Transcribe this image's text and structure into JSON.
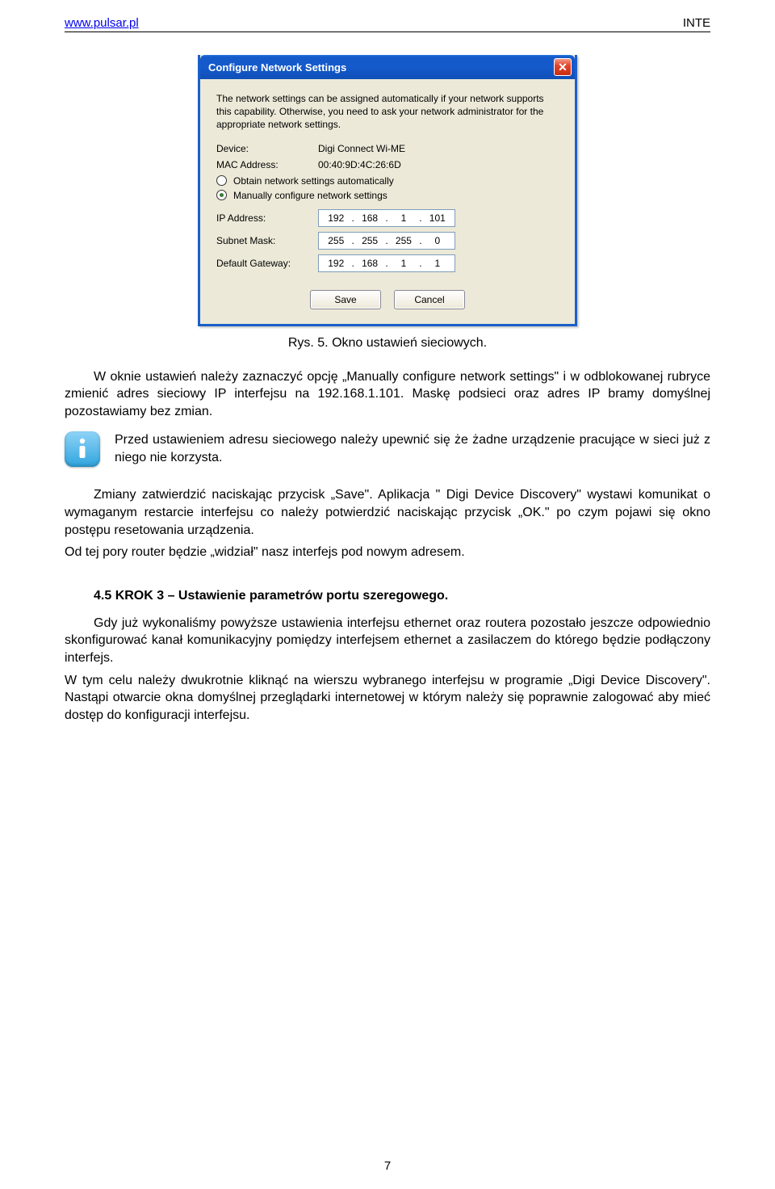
{
  "header": {
    "left_url": "www.pulsar.pl",
    "right": "INTE"
  },
  "dialog": {
    "title": "Configure Network Settings",
    "description": "The network settings can be assigned automatically if your network supports this capability. Otherwise, you need to ask your network administrator for the appropriate network settings.",
    "device_label": "Device:",
    "device_value": "Digi Connect Wi-ME",
    "mac_label": "MAC Address:",
    "mac_value": "00:40:9D:4C:26:6D",
    "radio_auto": "Obtain network settings automatically",
    "radio_manual": "Manually configure network settings",
    "ip_label": "IP Address:",
    "ip_value": [
      "192",
      "168",
      "1",
      "101"
    ],
    "mask_label": "Subnet Mask:",
    "mask_value": [
      "255",
      "255",
      "255",
      "0"
    ],
    "gw_label": "Default Gateway:",
    "gw_value": [
      "192",
      "168",
      "1",
      "1"
    ],
    "save": "Save",
    "cancel": "Cancel"
  },
  "caption": "Rys. 5. Okno ustawień sieciowych.",
  "body": {
    "p1": "W oknie ustawień należy zaznaczyć opcję „Manually configure network settings\" i w odblokowanej rubryce zmienić adres sieciowy IP interfejsu na 192.168.1.101. Maskę podsieci oraz adres IP bramy domyślnej pozostawiamy bez zmian.",
    "info": "Przed ustawieniem adresu sieciowego należy upewnić się że żadne urządzenie pracujące w sieci już z niego nie korzysta.",
    "p2": "Zmiany zatwierdzić naciskając przycisk „Save\". Aplikacja \" Digi Device Discovery\" wystawi komunikat o wymaganym restarcie interfejsu co należy potwierdzić naciskając przycisk „OK.\" po czym pojawi się okno postępu resetowania urządzenia.",
    "p3": "Od tej pory router będzie „widział\" nasz interfejs pod nowym adresem.",
    "section_title": "4.5 KROK 3 – Ustawienie parametrów portu szeregowego.",
    "p4": "Gdy już wykonaliśmy powyższe ustawienia interfejsu ethernet oraz routera pozostało jeszcze odpowiednio skonfigurować kanał komunikacyjny pomiędzy interfejsem ethernet a zasilaczem do którego będzie podłączony interfejs.",
    "p5": "W tym celu należy dwukrotnie kliknąć na wierszu wybranego interfejsu w programie „Digi Device Discovery\". Nastąpi otwarcie okna domyślnej przeglądarki internetowej w którym należy się poprawnie zalogować aby mieć dostęp do konfiguracji interfejsu."
  },
  "page_number": "7"
}
